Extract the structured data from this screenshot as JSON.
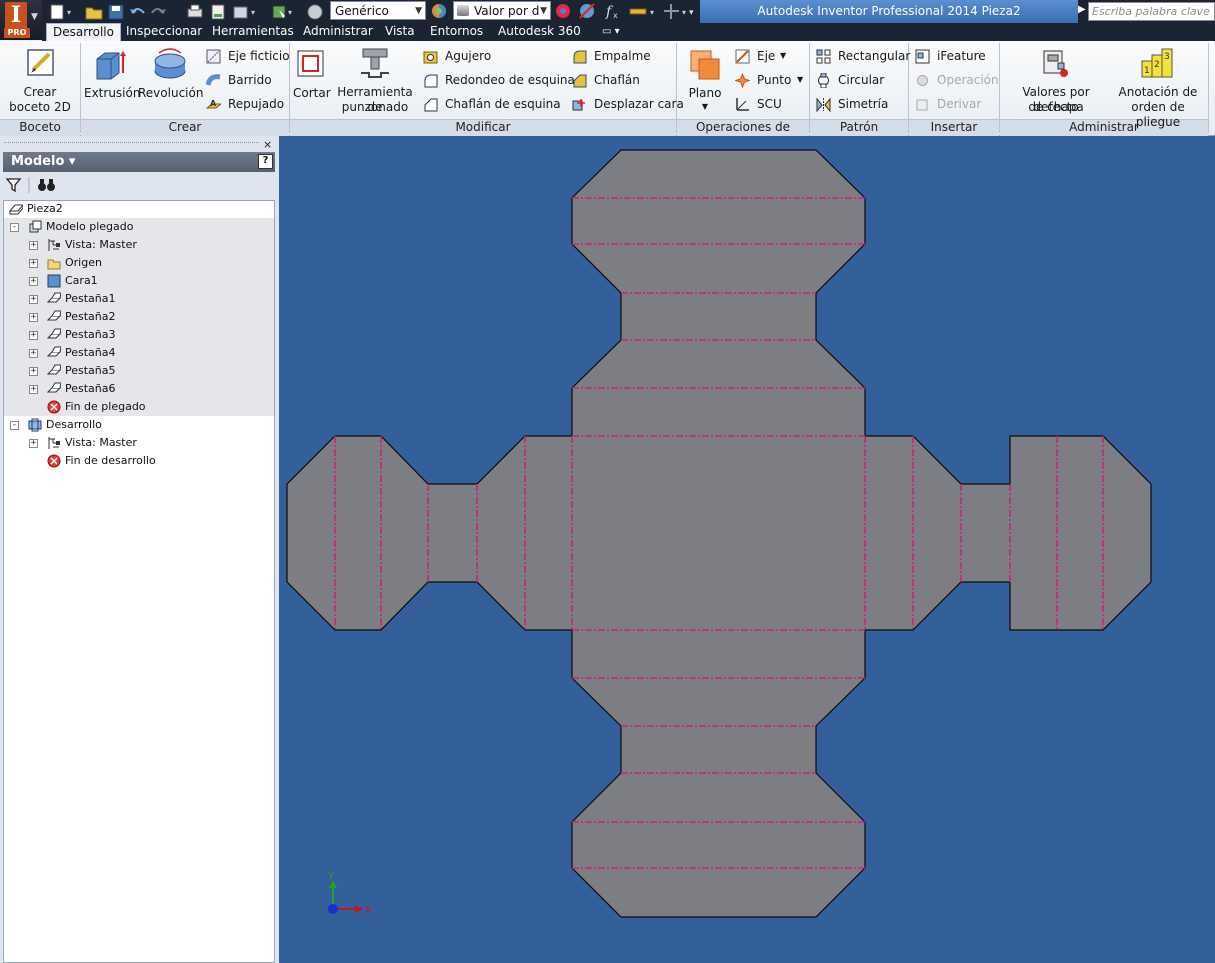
{
  "app": {
    "logo_letter": "I",
    "edition": "PRO",
    "title": "Autodesk Inventor Professional 2014    Pieza2",
    "search_placeholder": "Escriba palabra clave o frase"
  },
  "quick_access": {
    "material": "Genérico",
    "appearance": "Valor por d"
  },
  "tabs": [
    "Desarrollo",
    "Inspeccionar",
    "Herramientas",
    "Administrar",
    "Vista",
    "Entornos",
    "Autodesk 360"
  ],
  "active_tab": "Desarrollo",
  "ribbon": {
    "panels": [
      "Boceto",
      "Crear",
      "Modificar",
      "Operaciones de trabajo",
      "Patrón",
      "Insertar",
      "Administrar"
    ],
    "boceto": {
      "create_sketch": [
        "Crear",
        "boceto 2D"
      ]
    },
    "crear": {
      "extrusion": "Extrusión",
      "revolucion": "Revolución",
      "eje_ficticio": "Eje ficticio",
      "barrido": "Barrido",
      "repujado": "Repujado"
    },
    "modificar": {
      "cortar": "Cortar",
      "punch_tool": [
        "Herramienta de",
        "punzonado"
      ],
      "agujero": "Agujero",
      "redondeo": "Redondeo de esquina",
      "chaflan_esquina": "Chaflán de esquina",
      "empalme": "Empalme",
      "chaflan": "Chaflán",
      "desplazar_cara": "Desplazar cara"
    },
    "operaciones": {
      "plano": "Plano",
      "eje": "Eje",
      "punto": "Punto",
      "scu": "SCU"
    },
    "patron": {
      "rectangular": "Rectangular",
      "circular": "Circular",
      "simetria": "Simetría"
    },
    "insertar": {
      "ifeature": "iFeature",
      "operacion": "Operación",
      "derivar": "Derivar"
    },
    "administrar": {
      "valores": [
        "Valores por defecto",
        "de chapa"
      ],
      "anotacion": [
        "Anotación de",
        "orden de pliegue"
      ]
    }
  },
  "browser": {
    "close": "×",
    "header": "Modelo ▾",
    "help": "?",
    "tree": [
      {
        "label": "Pieza2",
        "level": 0,
        "icon": "part-icon",
        "toggle": ""
      },
      {
        "label": "Modelo plegado",
        "level": 1,
        "icon": "folded-model-icon",
        "toggle": "-"
      },
      {
        "label": "Vista: Master",
        "level": 2,
        "icon": "view-rep-icon",
        "toggle": "+"
      },
      {
        "label": "Origen",
        "level": 2,
        "icon": "folder-icon",
        "toggle": "+"
      },
      {
        "label": "Cara1",
        "level": 2,
        "icon": "face-icon",
        "toggle": "+"
      },
      {
        "label": "Pestaña1",
        "level": 2,
        "icon": "flange-icon",
        "toggle": "+"
      },
      {
        "label": "Pestaña2",
        "level": 2,
        "icon": "flange-icon",
        "toggle": "+"
      },
      {
        "label": "Pestaña3",
        "level": 2,
        "icon": "flange-icon",
        "toggle": "+"
      },
      {
        "label": "Pestaña4",
        "level": 2,
        "icon": "flange-icon",
        "toggle": "+"
      },
      {
        "label": "Pestaña5",
        "level": 2,
        "icon": "flange-icon",
        "toggle": "+"
      },
      {
        "label": "Pestaña6",
        "level": 2,
        "icon": "flange-icon",
        "toggle": "+"
      },
      {
        "label": "Fin de plegado",
        "level": 2,
        "icon": "end-of-part-icon",
        "toggle": ""
      },
      {
        "label": "Desarrollo",
        "level": 1,
        "icon": "flat-pattern-icon",
        "toggle": "-"
      },
      {
        "label": "Vista: Master",
        "level": 2,
        "icon": "view-rep-icon",
        "toggle": "+"
      },
      {
        "label": "Fin de desarrollo",
        "level": 2,
        "icon": "end-of-part-icon",
        "toggle": ""
      }
    ]
  },
  "viewport": {
    "axis_y": "Y",
    "axis_x": "X",
    "colors": {
      "background": "#33609a",
      "sheet": "#7d7e84",
      "bend_line": "#c8237a",
      "outline": "#0b0b0b"
    }
  }
}
